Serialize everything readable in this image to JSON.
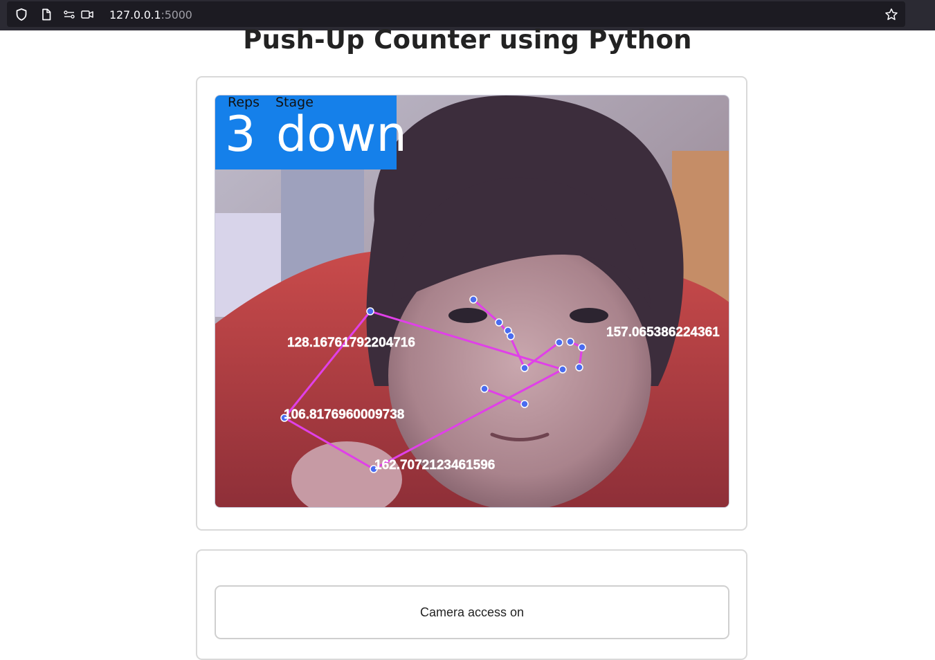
{
  "browser": {
    "url_host": "127.0.0.1",
    "url_port": ":5000"
  },
  "page": {
    "title": "Push-Up Counter using Python"
  },
  "video": {
    "overlay": {
      "reps_label": "Reps",
      "stage_label": "Stage",
      "reps_value": "3",
      "stage_value": "down",
      "panel_color": "#1580ea"
    },
    "angle_labels": [
      "128.16761792204716",
      "106.8176960009738",
      "162.7072123461596",
      "157.065386224361"
    ],
    "skeleton_color": "#e040e8",
    "joint_color": "#4a6cf0"
  },
  "controls": {
    "camera_button": "Camera access on"
  }
}
